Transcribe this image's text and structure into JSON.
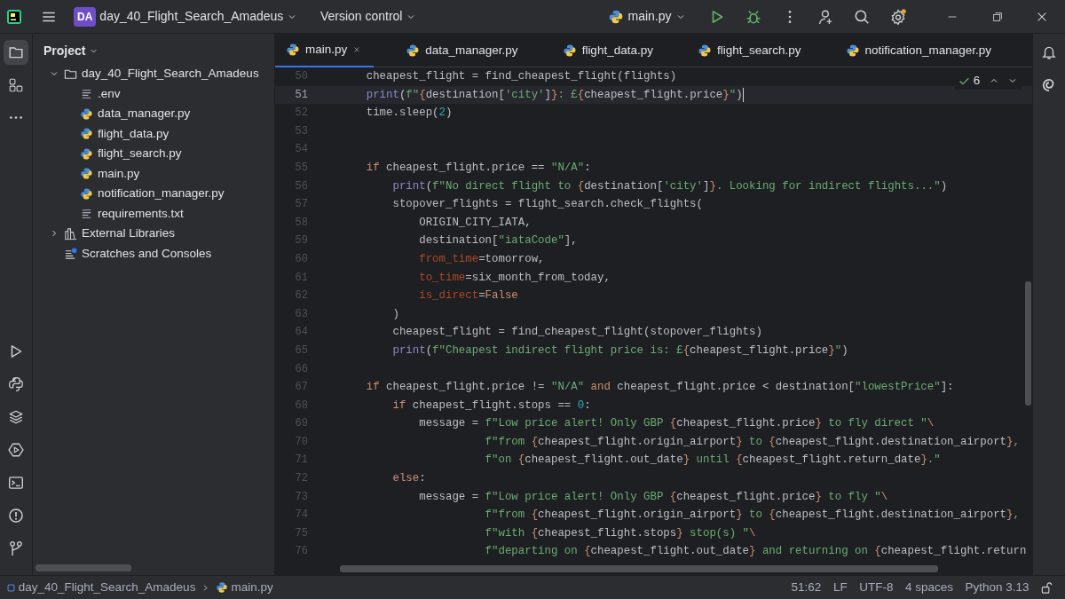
{
  "title_bar": {
    "project_badge": "DA",
    "project_name": "day_40_Flight_Search_Amadeus",
    "vcs_label": "Version control",
    "run_config": "main.py"
  },
  "left_toolbar": [
    {
      "kind": "project",
      "selected": true
    },
    {
      "kind": "structure",
      "selected": false
    },
    {
      "kind": "more",
      "selected": false
    },
    {
      "kind": "run",
      "selected": false
    },
    {
      "kind": "python-console",
      "selected": false
    },
    {
      "kind": "layers",
      "selected": false
    },
    {
      "kind": "services",
      "selected": false
    },
    {
      "kind": "terminal",
      "selected": false
    },
    {
      "kind": "problems",
      "selected": false
    },
    {
      "kind": "git",
      "selected": false
    }
  ],
  "project_panel": {
    "title": "Project",
    "tree": [
      {
        "label": "day_40_Flight_Search_Amadeus",
        "kind": "folder",
        "expanded": true,
        "children": [
          {
            "label": ".env",
            "kind": "text"
          },
          {
            "label": "data_manager.py",
            "kind": "python"
          },
          {
            "label": "flight_data.py",
            "kind": "python"
          },
          {
            "label": "flight_search.py",
            "kind": "python"
          },
          {
            "label": "main.py",
            "kind": "python"
          },
          {
            "label": "notification_manager.py",
            "kind": "python"
          },
          {
            "label": "requirements.txt",
            "kind": "text"
          }
        ]
      },
      {
        "label": "External Libraries",
        "kind": "library",
        "expanded": false
      },
      {
        "label": "Scratches and Consoles",
        "kind": "scratch"
      }
    ]
  },
  "tabs": [
    {
      "label": "main.py",
      "selected": true
    },
    {
      "label": "data_manager.py",
      "selected": false
    },
    {
      "label": "flight_data.py",
      "selected": false
    },
    {
      "label": "flight_search.py",
      "selected": false
    },
    {
      "label": "notification_manager.py",
      "selected": false
    }
  ],
  "inspections": {
    "count": "6"
  },
  "code_lines": [
    {
      "number": "50",
      "current": false,
      "tokens": [
        {
          "kind": "plain",
          "text": "    cheapest_flight = find_cheapest_flight(flights)"
        }
      ]
    },
    {
      "number": "51",
      "current": true,
      "tokens": [
        {
          "kind": "builtin",
          "text": "    print"
        },
        {
          "kind": "plain",
          "text": "("
        },
        {
          "kind": "string",
          "text": "f\""
        },
        {
          "kind": "brace",
          "text": "{"
        },
        {
          "kind": "plain",
          "text": "destination["
        },
        {
          "kind": "string",
          "text": "'city'"
        },
        {
          "kind": "plain",
          "text": "]"
        },
        {
          "kind": "brace",
          "text": "}"
        },
        {
          "kind": "string",
          "text": ": £"
        },
        {
          "kind": "brace",
          "text": "{"
        },
        {
          "kind": "plain",
          "text": "cheapest_flight.price"
        },
        {
          "kind": "brace",
          "text": "}"
        },
        {
          "kind": "string",
          "text": "\""
        },
        {
          "kind": "plain",
          "text": ")"
        }
      ]
    },
    {
      "number": "52",
      "current": false,
      "tokens": [
        {
          "kind": "plain",
          "text": "    time.sleep("
        },
        {
          "kind": "number",
          "text": "2"
        },
        {
          "kind": "plain",
          "text": ")"
        }
      ]
    },
    {
      "number": "53",
      "current": false
    },
    {
      "number": "54",
      "current": false
    },
    {
      "number": "55",
      "current": false,
      "tokens": [
        {
          "kind": "keyword",
          "text": "    if"
        },
        {
          "kind": "plain",
          "text": " cheapest_flight.price == "
        },
        {
          "kind": "string",
          "text": "\"N/A\""
        },
        {
          "kind": "plain",
          "text": ":"
        }
      ]
    },
    {
      "number": "56",
      "current": false,
      "tokens": [
        {
          "kind": "builtin",
          "text": "        print"
        },
        {
          "kind": "plain",
          "text": "("
        },
        {
          "kind": "string",
          "text": "f\"No direct flight to "
        },
        {
          "kind": "brace",
          "text": "{"
        },
        {
          "kind": "plain",
          "text": "destination["
        },
        {
          "kind": "string",
          "text": "'city'"
        },
        {
          "kind": "plain",
          "text": "]"
        },
        {
          "kind": "brace",
          "text": "}"
        },
        {
          "kind": "string",
          "text": ". Looking for indirect flights...\""
        },
        {
          "kind": "plain",
          "text": ")"
        }
      ]
    },
    {
      "number": "57",
      "current": false,
      "tokens": [
        {
          "kind": "plain",
          "text": "        stopover_flights = flight_search.check_flights("
        }
      ]
    },
    {
      "number": "58",
      "current": false,
      "tokens": [
        {
          "kind": "plain",
          "text": "            ORIGIN_CITY_IATA,"
        }
      ]
    },
    {
      "number": "59",
      "current": false,
      "tokens": [
        {
          "kind": "plain",
          "text": "            destination["
        },
        {
          "kind": "string",
          "text": "\"iataCode\""
        },
        {
          "kind": "plain",
          "text": "],"
        }
      ]
    },
    {
      "number": "60",
      "current": false,
      "tokens": [
        {
          "kind": "param",
          "text": "            from_time"
        },
        {
          "kind": "plain",
          "text": "=tomorrow,"
        }
      ]
    },
    {
      "number": "61",
      "current": false,
      "tokens": [
        {
          "kind": "param",
          "text": "            to_time"
        },
        {
          "kind": "plain",
          "text": "=six_month_from_today,"
        }
      ]
    },
    {
      "number": "62",
      "current": false,
      "tokens": [
        {
          "kind": "param",
          "text": "            is_direct"
        },
        {
          "kind": "plain",
          "text": "="
        },
        {
          "kind": "keyword",
          "text": "False"
        }
      ]
    },
    {
      "number": "63",
      "current": false,
      "tokens": [
        {
          "kind": "plain",
          "text": "        )"
        }
      ]
    },
    {
      "number": "64",
      "current": false,
      "tokens": [
        {
          "kind": "plain",
          "text": "        cheapest_flight = find_cheapest_flight(stopover_flights)"
        }
      ]
    },
    {
      "number": "65",
      "current": false,
      "tokens": [
        {
          "kind": "builtin",
          "text": "        print"
        },
        {
          "kind": "plain",
          "text": "("
        },
        {
          "kind": "string",
          "text": "f\"Cheapest indirect flight price is: £"
        },
        {
          "kind": "brace",
          "text": "{"
        },
        {
          "kind": "plain",
          "text": "cheapest_flight.price"
        },
        {
          "kind": "brace",
          "text": "}"
        },
        {
          "kind": "string",
          "text": "\""
        },
        {
          "kind": "plain",
          "text": ")"
        }
      ]
    },
    {
      "number": "66",
      "current": false
    },
    {
      "number": "67",
      "current": false,
      "tokens": [
        {
          "kind": "keyword",
          "text": "    if"
        },
        {
          "kind": "plain",
          "text": " cheapest_flight.price != "
        },
        {
          "kind": "string",
          "text": "\"N/A\""
        },
        {
          "kind": "keyword",
          "text": " and"
        },
        {
          "kind": "plain",
          "text": " cheapest_flight.price < destination["
        },
        {
          "kind": "string",
          "text": "\"lowestPrice\""
        },
        {
          "kind": "plain",
          "text": "]:"
        }
      ]
    },
    {
      "number": "68",
      "current": false,
      "tokens": [
        {
          "kind": "keyword",
          "text": "        if"
        },
        {
          "kind": "plain",
          "text": " cheapest_flight.stops == "
        },
        {
          "kind": "number",
          "text": "0"
        },
        {
          "kind": "plain",
          "text": ":"
        }
      ]
    },
    {
      "number": "69",
      "current": false,
      "tokens": [
        {
          "kind": "plain",
          "text": "            message = "
        },
        {
          "kind": "string",
          "text": "f\"Low price alert! Only GBP "
        },
        {
          "kind": "brace",
          "text": "{"
        },
        {
          "kind": "plain",
          "text": "cheapest_flight.price"
        },
        {
          "kind": "brace",
          "text": "}"
        },
        {
          "kind": "string",
          "text": " to fly direct \""
        },
        {
          "kind": "keyword",
          "text": "\\"
        }
      ]
    },
    {
      "number": "70",
      "current": false,
      "tokens": [
        {
          "kind": "string",
          "text": "                      f\"from "
        },
        {
          "kind": "brace",
          "text": "{"
        },
        {
          "kind": "plain",
          "text": "cheapest_flight.origin_airport"
        },
        {
          "kind": "brace",
          "text": "}"
        },
        {
          "kind": "string",
          "text": " to "
        },
        {
          "kind": "brace",
          "text": "{"
        },
        {
          "kind": "plain",
          "text": "cheapest_flight.destination_airport"
        },
        {
          "kind": "brace",
          "text": "}"
        },
        {
          "kind": "string",
          "text": ","
        }
      ]
    },
    {
      "number": "71",
      "current": false,
      "tokens": [
        {
          "kind": "string",
          "text": "                      f\"on "
        },
        {
          "kind": "brace",
          "text": "{"
        },
        {
          "kind": "plain",
          "text": "cheapest_flight.out_date"
        },
        {
          "kind": "brace",
          "text": "}"
        },
        {
          "kind": "string",
          "text": " until "
        },
        {
          "kind": "brace",
          "text": "{"
        },
        {
          "kind": "plain",
          "text": "cheapest_flight.return_date"
        },
        {
          "kind": "brace",
          "text": "}"
        },
        {
          "kind": "string",
          "text": ".\""
        }
      ]
    },
    {
      "number": "72",
      "current": false,
      "tokens": [
        {
          "kind": "keyword",
          "text": "        else"
        },
        {
          "kind": "plain",
          "text": ":"
        }
      ]
    },
    {
      "number": "73",
      "current": false,
      "tokens": [
        {
          "kind": "plain",
          "text": "            message = "
        },
        {
          "kind": "string",
          "text": "f\"Low price alert! Only GBP "
        },
        {
          "kind": "brace",
          "text": "{"
        },
        {
          "kind": "plain",
          "text": "cheapest_flight.price"
        },
        {
          "kind": "brace",
          "text": "}"
        },
        {
          "kind": "string",
          "text": " to fly \""
        },
        {
          "kind": "keyword",
          "text": "\\"
        }
      ]
    },
    {
      "number": "74",
      "current": false,
      "tokens": [
        {
          "kind": "string",
          "text": "                      f\"from "
        },
        {
          "kind": "brace",
          "text": "{"
        },
        {
          "kind": "plain",
          "text": "cheapest_flight.origin_airport"
        },
        {
          "kind": "brace",
          "text": "}"
        },
        {
          "kind": "string",
          "text": " to "
        },
        {
          "kind": "brace",
          "text": "{"
        },
        {
          "kind": "plain",
          "text": "cheapest_flight.destination_airport"
        },
        {
          "kind": "brace",
          "text": "}"
        },
        {
          "kind": "string",
          "text": ","
        }
      ]
    },
    {
      "number": "75",
      "current": false,
      "tokens": [
        {
          "kind": "string",
          "text": "                      f\"with "
        },
        {
          "kind": "brace",
          "text": "{"
        },
        {
          "kind": "plain",
          "text": "cheapest_flight.stops"
        },
        {
          "kind": "brace",
          "text": "}"
        },
        {
          "kind": "string",
          "text": " stop(s) \""
        },
        {
          "kind": "keyword",
          "text": "\\"
        }
      ]
    },
    {
      "number": "76",
      "current": false,
      "tokens": [
        {
          "kind": "string",
          "text": "                      f\"departing on "
        },
        {
          "kind": "brace",
          "text": "{"
        },
        {
          "kind": "plain",
          "text": "cheapest_flight.out_date"
        },
        {
          "kind": "brace",
          "text": "}"
        },
        {
          "kind": "string",
          "text": " and returning on "
        },
        {
          "kind": "brace",
          "text": "{"
        },
        {
          "kind": "plain",
          "text": "cheapest_flight.return"
        }
      ]
    }
  ],
  "status_bar": {
    "breadcrumbs": [
      "day_40_Flight_Search_Amadeus",
      "main.py"
    ],
    "position": "51:62",
    "line_separator": "LF",
    "encoding": "UTF-8",
    "indent": "4 spaces",
    "interpreter": "Python 3.13"
  }
}
